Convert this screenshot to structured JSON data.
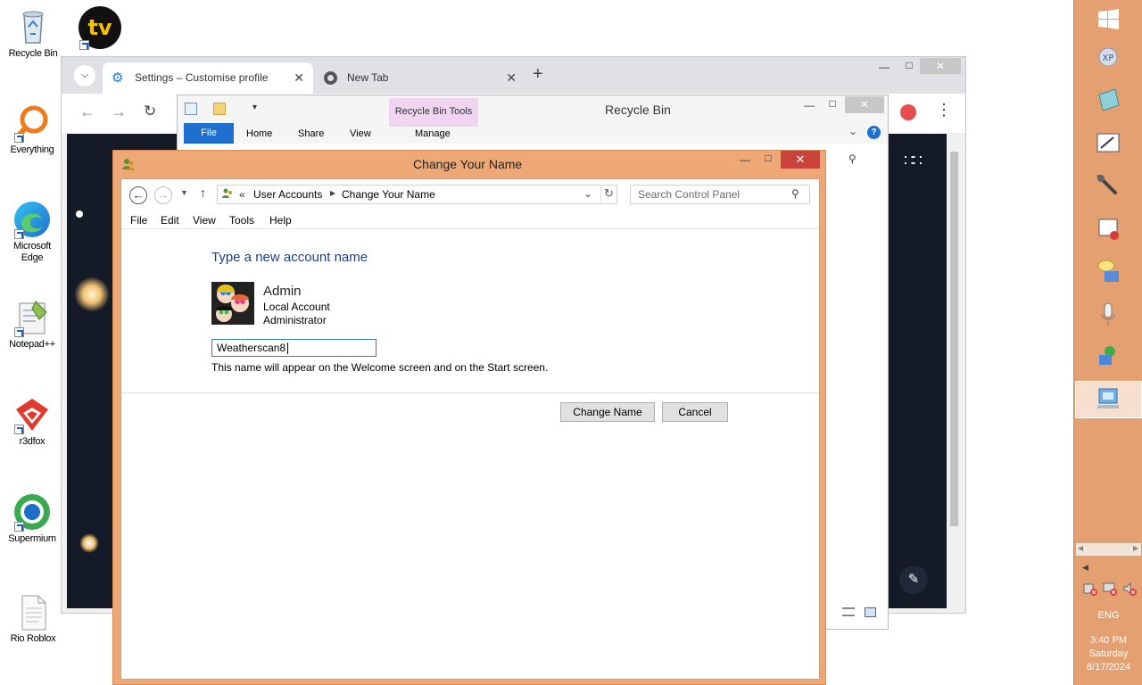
{
  "desktop": {
    "icons": [
      {
        "label": "Recycle Bin"
      },
      {
        "label": ""
      },
      {
        "label": "Everything"
      },
      {
        "label": "Microsoft Edge"
      },
      {
        "label": "Notepad++"
      },
      {
        "label": "r3dfox"
      },
      {
        "label": "Supermium"
      },
      {
        "label": "Rio Roblox"
      }
    ]
  },
  "browser": {
    "tabs": [
      {
        "label": "Settings – Customise profile"
      },
      {
        "label": "New Tab"
      }
    ]
  },
  "explorer": {
    "title": "Recycle Bin",
    "context_tab_group": "Recycle Bin Tools",
    "ribbon_tabs": [
      "File",
      "Home",
      "Share",
      "View",
      "Manage"
    ]
  },
  "dialog": {
    "title": "Change Your Name",
    "breadcrumb": {
      "prefix": "«",
      "items": [
        "User Accounts",
        "Change Your Name"
      ]
    },
    "search_placeholder": "Search Control Panel",
    "menu": [
      "File",
      "Edit",
      "View",
      "Tools",
      "Help"
    ],
    "heading": "Type a new account name",
    "account": {
      "name": "Admin",
      "type": "Local Account",
      "role": "Administrator"
    },
    "name_input_value": "Weatherscan8",
    "hint": "This name will appear on the Welcome screen and on the Start screen.",
    "change_button": "Change Name",
    "cancel_button": "Cancel"
  },
  "taskbar": {
    "language": "ENG",
    "time": "3:40 PM",
    "day": "Saturday",
    "date": "8/17/2024"
  },
  "colors": {
    "window_frame": "#eea876",
    "taskbar": "#e4a070",
    "close_button": "#c7433b",
    "accent_blue": "#1e6fce",
    "heading_blue": "#1e3e8c"
  }
}
